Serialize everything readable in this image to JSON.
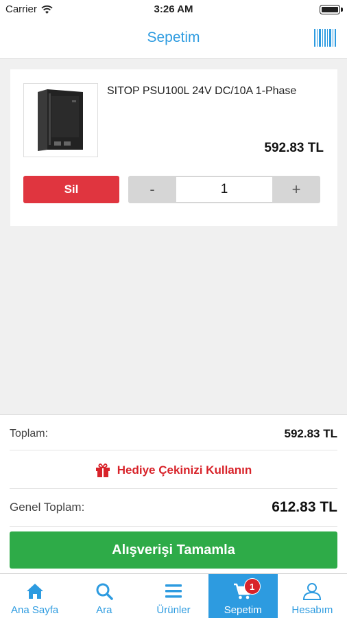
{
  "status_bar": {
    "carrier": "Carrier",
    "time": "3:26 AM"
  },
  "nav": {
    "title": "Sepetim",
    "barcode_icon": "barcode-icon"
  },
  "cart": {
    "items": [
      {
        "name": "SITOP PSU100L 24V DC/10A 1-Phase",
        "price": "592.83 TL",
        "quantity": "1",
        "delete_label": "Sil",
        "decrement_label": "-",
        "increment_label": "+"
      }
    ]
  },
  "summary": {
    "total_label": "Toplam:",
    "total_value": "592.83 TL",
    "gift_label": "Hediye Çekinizi Kullanın",
    "grand_total_label": "Genel Toplam:",
    "grand_total_value": "612.83 TL",
    "checkout_label": "Alışverişi Tamamla"
  },
  "tabs": [
    {
      "label": "Ana Sayfa",
      "icon": "home-icon"
    },
    {
      "label": "Ara",
      "icon": "search-icon"
    },
    {
      "label": "Ürünler",
      "icon": "menu-icon"
    },
    {
      "label": "Sepetim",
      "icon": "cart-icon",
      "badge": "1",
      "active": true
    },
    {
      "label": "Hesabım",
      "icon": "user-icon"
    }
  ],
  "colors": {
    "accent": "#2d9be0",
    "delete": "#e0353f",
    "checkout": "#2eab48",
    "gift": "#d8232a"
  }
}
